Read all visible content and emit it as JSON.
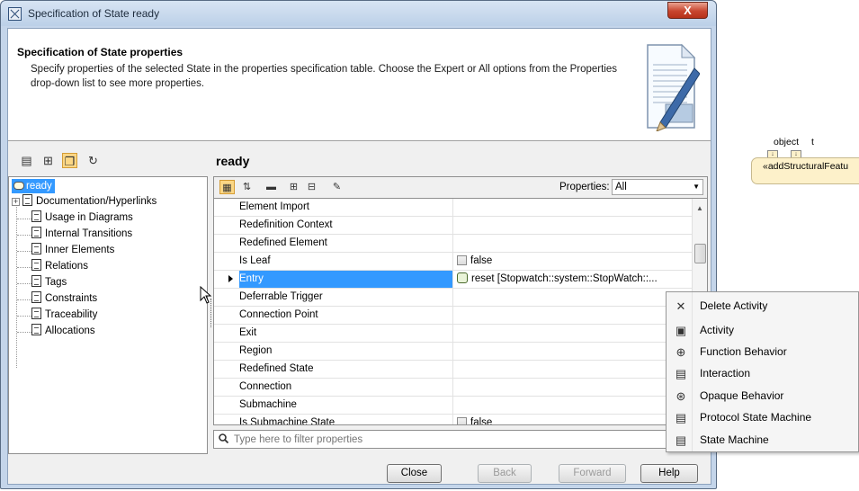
{
  "window": {
    "title": "Specification of State ready",
    "close_glyph": "X"
  },
  "header": {
    "title": "Specification of State properties",
    "description": "Specify properties of the selected State in the properties specification table. Choose the Expert or All options from the Properties drop-down list to see more properties."
  },
  "tree": {
    "root": "ready",
    "items": [
      "Documentation/Hyperlinks",
      "Usage in Diagrams",
      "Internal Transitions",
      "Inner Elements",
      "Relations",
      "Tags",
      "Constraints",
      "Traceability",
      "Allocations"
    ]
  },
  "panel": {
    "title": "ready",
    "properties_label": "Properties:",
    "properties_value": "All"
  },
  "grid": {
    "rows": [
      {
        "name": "Element Import",
        "value": ""
      },
      {
        "name": "Redefinition Context",
        "value": ""
      },
      {
        "name": "Redefined Element",
        "value": ""
      },
      {
        "name": "Is Leaf",
        "value": "false"
      },
      {
        "name": "Entry",
        "value": "reset [Stopwatch::system::StopWatch::..."
      },
      {
        "name": "Deferrable Trigger",
        "value": ""
      },
      {
        "name": "Connection Point",
        "value": ""
      },
      {
        "name": "Exit",
        "value": ""
      },
      {
        "name": "Region",
        "value": ""
      },
      {
        "name": "Redefined State",
        "value": ""
      },
      {
        "name": "Connection",
        "value": ""
      },
      {
        "name": "Submachine",
        "value": ""
      },
      {
        "name": "Is Submachine State",
        "value": "false"
      }
    ],
    "selected_row": "Entry"
  },
  "filter": {
    "placeholder": "Type here to filter properties"
  },
  "buttons": {
    "close": "Close",
    "back": "Back",
    "forward": "Forward",
    "help": "Help"
  },
  "context_menu": {
    "items": [
      {
        "label": "Delete Activity",
        "icon": "delete-x-icon"
      },
      {
        "label": "Activity",
        "icon": "activity-icon"
      },
      {
        "label": "Function Behavior",
        "icon": "function-behavior-icon"
      },
      {
        "label": "Interaction",
        "icon": "interaction-icon"
      },
      {
        "label": "Opaque Behavior",
        "icon": "opaque-behavior-icon"
      },
      {
        "label": "Protocol State Machine",
        "icon": "protocol-state-machine-icon"
      },
      {
        "label": "State Machine",
        "icon": "state-machine-icon"
      }
    ]
  },
  "diagram": {
    "pin1": "object",
    "pin2": "t",
    "node_label": "«addStructuralFeatu"
  },
  "colors": {
    "selection": "#3399ff",
    "window_frame": "#c4d5ea",
    "active_toolbar": "#fbd785",
    "diagram_node": "#fdf1ca"
  }
}
